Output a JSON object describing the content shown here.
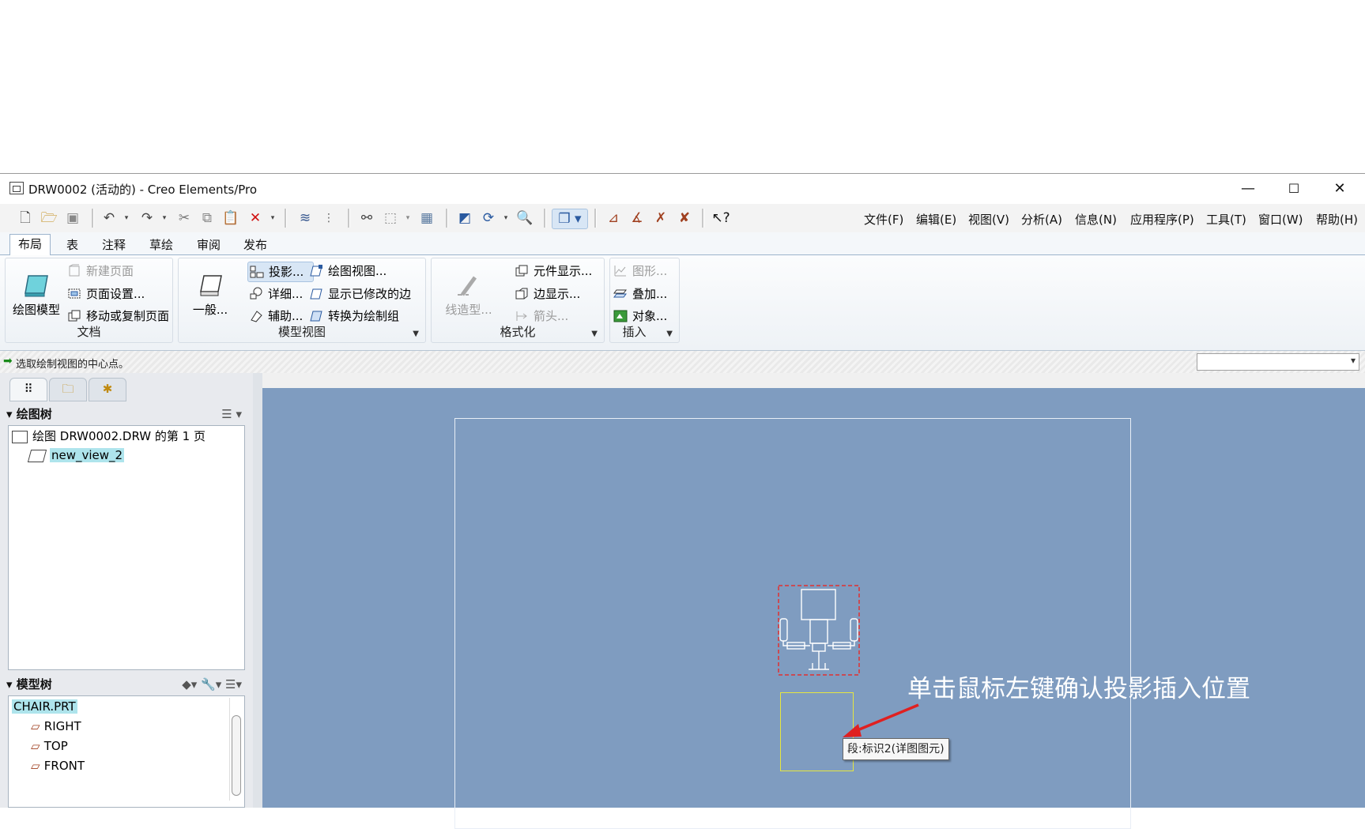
{
  "window": {
    "title": "DRW0002 (活动的) - Creo Elements/Pro",
    "minimize": "—",
    "maximize": "☐",
    "close": "✕"
  },
  "menus": [
    "文件(F)",
    "编辑(E)",
    "视图(V)",
    "分析(A)",
    "信息(N)",
    "应用程序(P)",
    "工具(T)",
    "窗口(W)",
    "帮助(H)"
  ],
  "toolbar_icons": [
    "new-icon",
    "open-icon",
    "save-icon",
    "undo-icon",
    "redo-icon",
    "cut-icon",
    "copy-icon",
    "paste-icon",
    "delete-icon",
    "layer-icon",
    "model-tree-icon",
    "find-icon",
    "select-box-icon",
    "properties-icon",
    "redraw-icon",
    "regenerate-icon",
    "zoom-icon",
    "display-style-icon",
    "dimension-icon",
    "note-icon",
    "erase-icon",
    "delete-all-icon",
    "whats-this-icon"
  ],
  "tabs": [
    "布局",
    "表",
    "注释",
    "草绘",
    "审阅",
    "发布"
  ],
  "ribbon": {
    "document": {
      "label": "文档",
      "draw_model": "绘图模型",
      "new_page": "新建页面",
      "page_setup": "页面设置...",
      "move_copy_page": "移动或复制页面"
    },
    "model_views": {
      "label": "模型视图",
      "general": "一般...",
      "projection": "投影...",
      "detailed": "详细...",
      "auxiliary": "辅助...",
      "drawing_view": "绘图视图...",
      "show_modified_edges": "显示已修改的边",
      "convert_to_draft_group": "转换为绘制组"
    },
    "format": {
      "label": "格式化",
      "line_style": "线造型...",
      "component_display": "元件显示...",
      "edge_display": "边显示...",
      "arrow": "箭头..."
    },
    "insert": {
      "label": "插入",
      "graph": "图形...",
      "overlay": "叠加...",
      "object": "对象..."
    }
  },
  "status": {
    "message": "选取绘制视图的中心点。"
  },
  "drawing_tree": {
    "header": "绘图树",
    "root": "绘图 DRW0002.DRW 的第 1 页",
    "items": [
      "new_view_2"
    ]
  },
  "model_tree": {
    "header": "模型树",
    "root": "CHAIR.PRT",
    "items": [
      "RIGHT",
      "TOP",
      "FRONT"
    ]
  },
  "canvas": {
    "annotation": "单击鼠标左键确认投影插入位置",
    "tooltip": "段:标识2(详图图元)",
    "colors": {
      "background": "#7f9cc0",
      "sheet_border": "#e8eef6",
      "view_outline": "#e03030",
      "projection_box": "#e6e640",
      "arrow": "#e02020"
    }
  }
}
